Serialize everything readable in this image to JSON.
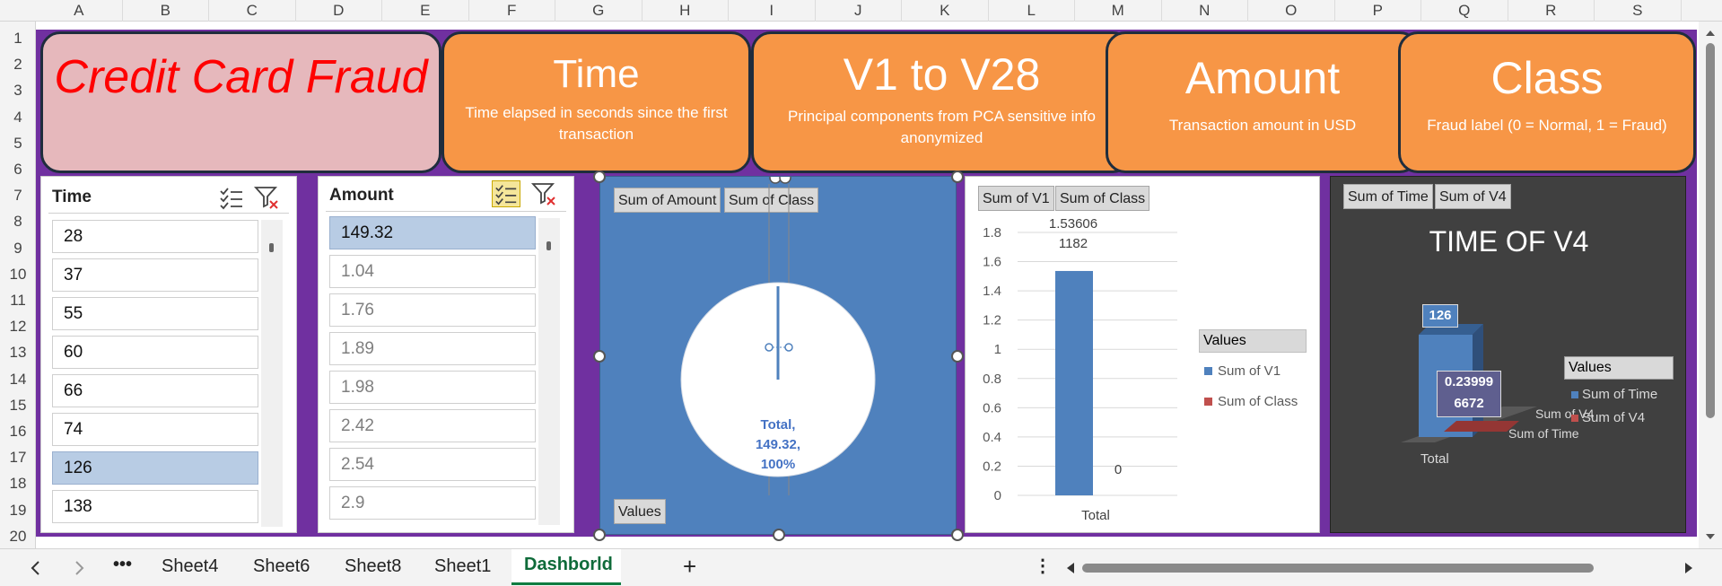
{
  "columns": [
    "A",
    "B",
    "C",
    "D",
    "E",
    "F",
    "G",
    "H",
    "I",
    "J",
    "K",
    "L",
    "M",
    "N",
    "O",
    "P",
    "Q",
    "R",
    "S"
  ],
  "rows": [
    "1",
    "2",
    "3",
    "4",
    "5",
    "6",
    "7",
    "8",
    "9",
    "10",
    "11",
    "12",
    "13",
    "14",
    "15",
    "16",
    "17",
    "18",
    "19",
    "20"
  ],
  "header": {
    "title": "Credit Card Fraud",
    "cards": [
      {
        "title": "Time",
        "desc": "Time elapsed in seconds since the first transaction"
      },
      {
        "title": "V1 to V28",
        "desc": "Principal components from PCA sensitive info anonymized"
      },
      {
        "title": "Amount",
        "desc": "Transaction amount in USD"
      },
      {
        "title": "Class",
        "desc": "Fraud label (0 = Normal, 1 = Fraud)"
      }
    ]
  },
  "slicers": {
    "time": {
      "header": "Time",
      "items": [
        "28",
        "37",
        "55",
        "60",
        "66",
        "74",
        "126",
        "138"
      ],
      "selected": "126"
    },
    "amount": {
      "header": "Amount",
      "items": [
        "149.32",
        "1.04",
        "1.76",
        "1.89",
        "1.98",
        "2.42",
        "2.54",
        "2.9"
      ],
      "selected": "149.32"
    }
  },
  "pie_chart": {
    "field_buttons": [
      "Sum of Amount",
      "Sum of Class"
    ],
    "values_button": "Values",
    "label_lines": [
      "Total,",
      "149.32,",
      "100%"
    ],
    "bg": "#4f81bd"
  },
  "bar_chart": {
    "field_buttons": [
      "Sum of V1",
      "Sum of Class"
    ],
    "data_labels": [
      "1.53606",
      "1182",
      "0"
    ],
    "legend_title": "Values",
    "legend": [
      "Sum of V1",
      "Sum of Class"
    ],
    "yticks": [
      "1.8",
      "1.6",
      "1.4",
      "1.2",
      "1",
      "0.8",
      "0.6",
      "0.4",
      "0.2",
      "0"
    ]
  },
  "v4_chart": {
    "field_buttons": [
      "Sum of Time",
      "Sum of V4"
    ],
    "title": "TIME OF V4",
    "data_labels": [
      "126",
      "0.23999",
      "6672"
    ],
    "axis_labels": [
      "Sum of V4",
      "Sum of Time"
    ],
    "x_label": "Total",
    "legend_title": "Values",
    "legend": [
      "Sum of Time",
      "Sum of V4"
    ]
  },
  "chart_data": [
    {
      "type": "pie",
      "categories": [
        "Total"
      ],
      "values": [
        149.32
      ],
      "title": ""
    },
    {
      "type": "bar",
      "categories": [
        "Total"
      ],
      "series": [
        {
          "name": "Sum of V1",
          "values": [
            1.53606
          ]
        },
        {
          "name": "Sum of Class",
          "values": [
            0
          ]
        }
      ],
      "ylim": [
        0,
        1.8
      ],
      "xlabel": "Total",
      "legend": "right",
      "grid": true
    },
    {
      "type": "bar",
      "title": "TIME OF V4",
      "categories": [
        "Total"
      ],
      "series": [
        {
          "name": "Sum of Time",
          "values": [
            126
          ]
        },
        {
          "name": "Sum of V4",
          "values": [
            0.239996672
          ]
        }
      ],
      "legend": "right"
    }
  ],
  "tabs": [
    "Sheet4",
    "Sheet6",
    "Sheet8",
    "Sheet1",
    "Dashborld"
  ],
  "active_tab": "Dashborld",
  "more_label": "•••",
  "add_label": "+",
  "colors": {
    "purple": "#7030a0",
    "orange": "#f79646",
    "blue": "#4f81bd",
    "red": "#c0504d",
    "title_red": "#ff0000"
  }
}
